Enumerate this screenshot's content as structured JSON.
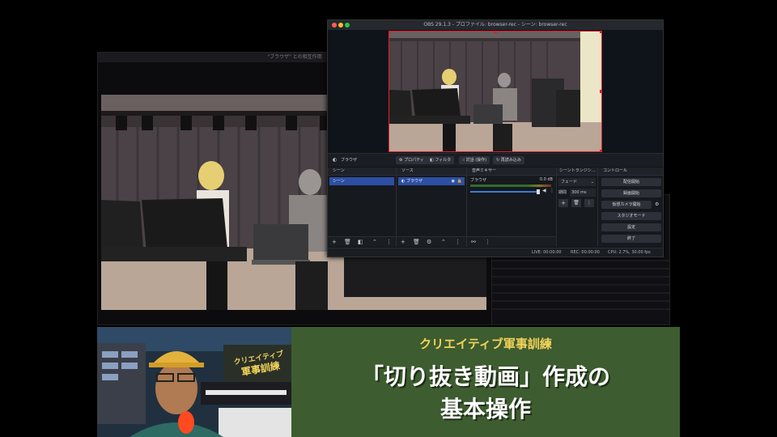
{
  "background_window": {
    "title": "\"ブラウザ\" との相互作用"
  },
  "obs": {
    "title": "OBS 29.1.3 - プロファイル: browser-rec - シーン: browser-rec",
    "source_label": "ブラウザ",
    "toolbar": {
      "properties": "プロパティ",
      "filters": "フィルタ",
      "interact": "対話 (操作)",
      "reload": "再読み込み"
    },
    "panels": {
      "scenes": {
        "header": "シーン",
        "items": [
          "シーン"
        ]
      },
      "sources": {
        "header": "ソース",
        "items": [
          "ブラウザ"
        ]
      },
      "mixer": {
        "header": "音声ミキサー",
        "channel": "ブラウザ",
        "level": "0.0 dB"
      },
      "transitions": {
        "header": "シーントランジシ…",
        "type": "フェード",
        "duration_label": "期間",
        "duration_value": "300 ms"
      },
      "controls": {
        "header": "コントロール",
        "buttons": [
          "配信開始",
          "録画開始",
          "仮想カメラ開始",
          "スタジオモード",
          "設定",
          "終了"
        ]
      }
    },
    "status": {
      "live": "LIVE: 00:00:00",
      "rec": "REC: 00:00:00",
      "cpu": "CPU: 2.7%, 30.00 fps"
    }
  },
  "webcam": {
    "sign_line1": "クリエイティブ",
    "sign_line2": "軍事訓練"
  },
  "banner": {
    "subtitle": "クリエイティブ軍事訓練",
    "title_line1": "「切り抜き動画」作成の",
    "title_line2": "基本操作"
  },
  "colors": {
    "banner_bg": "#3d5c2f",
    "banner_subtitle": "#f3d35a",
    "selection": "#2d4fa3",
    "crop_outline": "#e0202a"
  }
}
